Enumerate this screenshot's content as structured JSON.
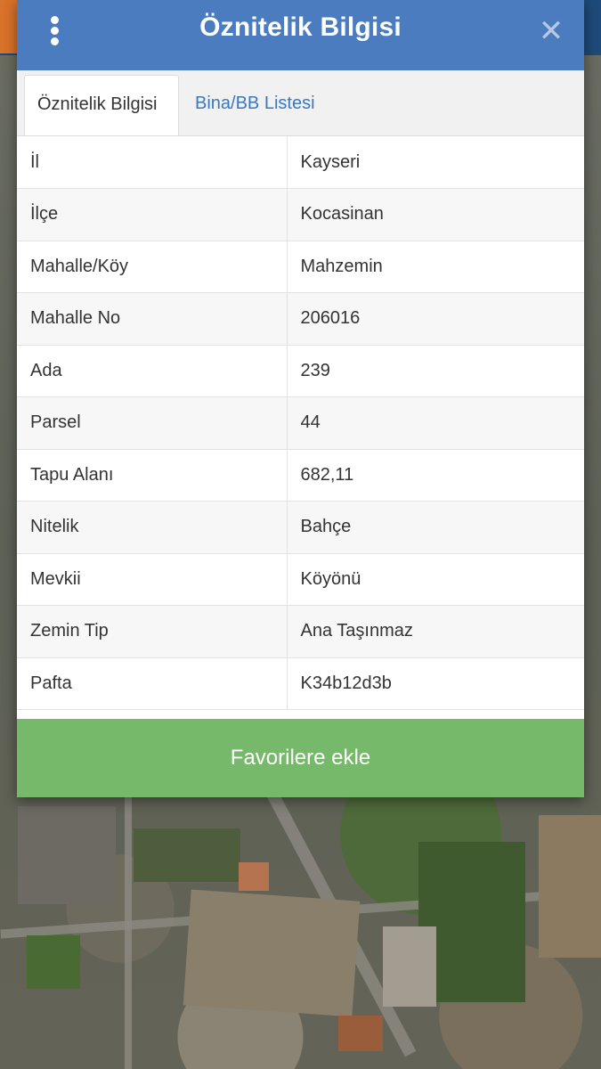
{
  "dialog": {
    "title": "Öznitelik Bilgisi",
    "icons": {
      "menu": "more-vertical-icon",
      "close": "close-icon"
    },
    "close_glyph": "✕"
  },
  "tabs": [
    {
      "label": "Öznitelik Bilgisi",
      "active": true
    },
    {
      "label": "Bina/BB Listesi",
      "active": false
    }
  ],
  "attributes": [
    {
      "key": "İl",
      "value": "Kayseri"
    },
    {
      "key": "İlçe",
      "value": "Kocasinan"
    },
    {
      "key": "Mahalle/Köy",
      "value": "Mahzemin"
    },
    {
      "key": "Mahalle No",
      "value": "206016"
    },
    {
      "key": "Ada",
      "value": "239"
    },
    {
      "key": "Parsel",
      "value": "44"
    },
    {
      "key": "Tapu Alanı",
      "value": "682,11"
    },
    {
      "key": "Nitelik",
      "value": "Bahçe"
    },
    {
      "key": "Mevkii",
      "value": "Köyönü"
    },
    {
      "key": "Zemin Tip",
      "value": "Ana Taşınmaz"
    },
    {
      "key": "Pafta",
      "value": "K34b12d3b"
    }
  ],
  "actions": {
    "favorite_label": "Favorilere ekle"
  },
  "colors": {
    "header": "#4a7cbf",
    "button": "#77b96a",
    "tab_link": "#3a78c0"
  }
}
